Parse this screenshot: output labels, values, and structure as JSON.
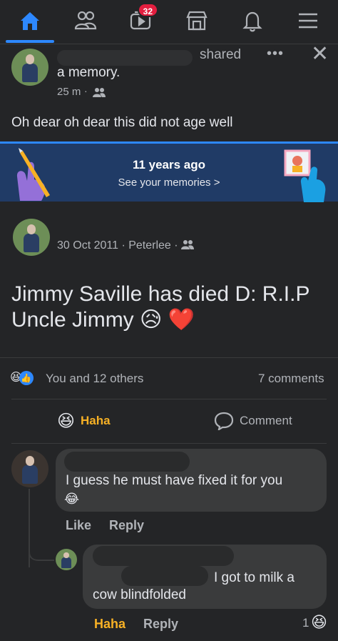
{
  "nav": {
    "tabs": [
      {
        "icon": "home-icon",
        "active": true
      },
      {
        "icon": "friends-icon"
      },
      {
        "icon": "watch-icon",
        "badge": "32"
      },
      {
        "icon": "marketplace-icon"
      },
      {
        "icon": "notifications-icon"
      },
      {
        "icon": "menu-icon"
      }
    ]
  },
  "share": {
    "verb": "shared",
    "object": "a memory.",
    "time": "25 m",
    "audience_icon": "friends-audience-icon",
    "body": "Oh dear oh dear this did not age well"
  },
  "memory_banner": {
    "title": "11 years ago",
    "link": "See your memories",
    "link_chevron": ">"
  },
  "original_post": {
    "date": "30 Oct 2011",
    "location": "Peterlee",
    "separator": "·",
    "text_line1": "Jimmy Saville has died D: R.I.P",
    "text_line2": "Uncle Jimmy",
    "emoji": [
      "😥",
      "❤️"
    ]
  },
  "reactions": {
    "emoji": [
      "😆",
      "👍"
    ],
    "summary": "You and 12 others",
    "comments": "7 comments"
  },
  "actions": {
    "haha_emoji": "😆",
    "haha": "Haha",
    "comment": "Comment"
  },
  "comments": [
    {
      "text": "I guess he must have fixed it for you",
      "emoji": "😂",
      "like": "Like",
      "reply": "Reply"
    },
    {
      "text_line1": "I got to milk a",
      "text_line2": "cow blindfolded",
      "reaction_label": "Haha",
      "reply": "Reply",
      "reaction_count": "1",
      "reaction_emoji": "😆"
    }
  ],
  "colors": {
    "background": "#242527",
    "accent": "#2d88ff",
    "banner": "#203b66",
    "haha": "#f7b125",
    "badge": "#e41e3f"
  }
}
